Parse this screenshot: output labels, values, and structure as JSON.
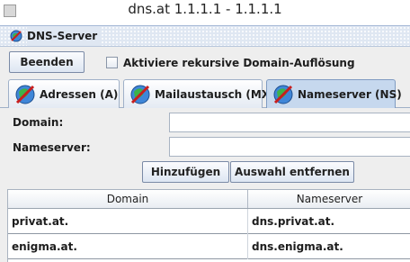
{
  "window": {
    "title": "dns.at 1.1.1.1 - 1.1.1.1",
    "icon": "app-window-icon"
  },
  "internal_frame": {
    "title": "DNS-Server",
    "icon": "globe-pin-icon"
  },
  "toolbar": {
    "quit_label": "Beenden",
    "recursive_label": "Aktiviere rekursive Domain-Auflösung",
    "recursive_checked": false
  },
  "tabs": [
    {
      "label": "Adressen (A)",
      "icon": "globe-pin-icon",
      "active": false
    },
    {
      "label": "Mailaustausch (MX)",
      "icon": "globe-pin-icon",
      "active": false
    },
    {
      "label": "Nameserver (NS)",
      "icon": "globe-pin-icon",
      "active": true
    }
  ],
  "form": {
    "domain_label": "Domain:",
    "domain_value": "",
    "nameserver_label": "Nameserver:",
    "nameserver_value": "",
    "add_label": "Hinzufügen",
    "remove_label": "Auswahl entfernen"
  },
  "table": {
    "columns": [
      "Domain",
      "Nameserver"
    ],
    "rows": [
      [
        "privat.at.",
        "dns.privat.at."
      ],
      [
        "enigma.at.",
        "dns.enigma.at."
      ]
    ]
  },
  "colors": {
    "active_tab": "#c6d8ee",
    "frame_titlebar": "#dfe7f2"
  }
}
